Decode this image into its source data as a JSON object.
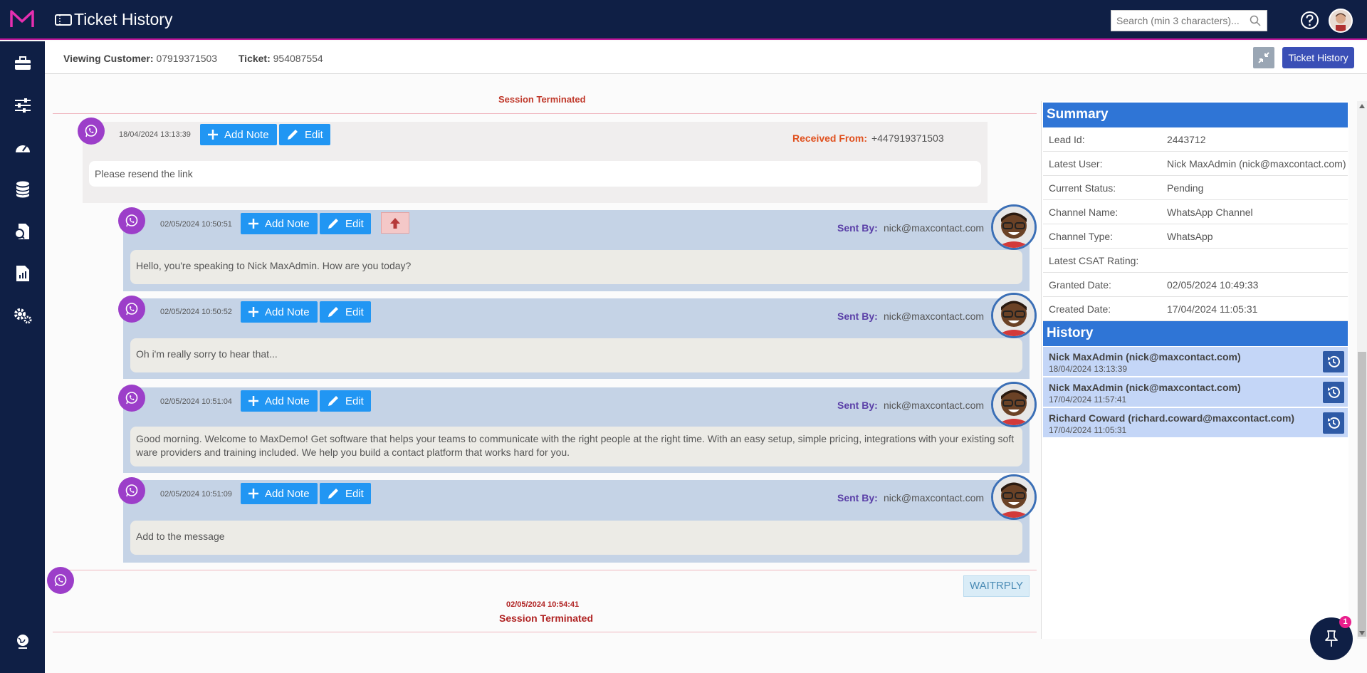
{
  "header": {
    "title": "Ticket History",
    "search_placeholder": "Search (min 3 characters)..."
  },
  "customer_bar": {
    "viewing_label": "Viewing Customer:",
    "viewing_value": "07919371503",
    "ticket_label": "Ticket:",
    "ticket_value": "954087554",
    "ticket_history_button": "Ticket History"
  },
  "chat": {
    "top_partial_status": "Session Terminated",
    "received_message": {
      "timestamp": "18/04/2024 13:13:39",
      "from_label": "Received From:",
      "from_value": "+447919371503",
      "text": "Please resend the link"
    },
    "buttons": {
      "add_note": "Add Note",
      "edit": "Edit"
    },
    "sent_by_label": "Sent By:",
    "sent_messages": [
      {
        "timestamp": "02/05/2024 10:50:51",
        "sender": "nick@maxcontact.com",
        "text": "Hello, you're speaking to Nick MaxAdmin. How are you today?"
      },
      {
        "timestamp": "02/05/2024 10:50:52",
        "sender": "nick@maxcontact.com",
        "text": "Oh i'm really sorry to hear that..."
      },
      {
        "timestamp": "02/05/2024 10:51:04",
        "sender": "nick@maxcontact.com",
        "text": "Good morning. Welcome to MaxDemo! Get software that helps your teams to communicate with the right people at the right time. With an easy setup, simple pricing, integrations with your existing software providers and training included. We help you build a contact platform that works hard for you."
      },
      {
        "timestamp": "02/05/2024 10:51:09",
        "sender": "nick@maxcontact.com",
        "text": "Add to the message"
      }
    ],
    "wait_badge": "WAITRPLY",
    "end_timestamp": "02/05/2024 10:54:41",
    "end_status": "Session Terminated"
  },
  "summary": {
    "title": "Summary",
    "rows": [
      {
        "key": "Lead Id:",
        "value": "2443712"
      },
      {
        "key": "Latest User:",
        "value": "Nick MaxAdmin (nick@maxcontact.com)"
      },
      {
        "key": "Current Status:",
        "value": "Pending"
      },
      {
        "key": "Channel Name:",
        "value": "WhatsApp Channel"
      },
      {
        "key": "Channel Type:",
        "value": "WhatsApp"
      },
      {
        "key": "Latest CSAT Rating:",
        "value": ""
      },
      {
        "key": "Granted Date:",
        "value": "02/05/2024 10:49:33"
      },
      {
        "key": "Created Date:",
        "value": "17/04/2024 11:05:31"
      }
    ]
  },
  "history": {
    "title": "History",
    "items": [
      {
        "name": "Nick MaxAdmin (nick@maxcontact.com)",
        "date": "18/04/2024 13:13:39"
      },
      {
        "name": "Nick MaxAdmin (nick@maxcontact.com)",
        "date": "17/04/2024 11:57:41"
      },
      {
        "name": "Richard Coward (richard.coward@maxcontact.com)",
        "date": "17/04/2024 11:05:31"
      }
    ]
  },
  "pin_badge": "1",
  "colors": {
    "navy": "#0f1f45",
    "accent_pink": "#c0189b",
    "button_blue": "#2196f3",
    "panel_blue": "#2f75d6",
    "whatsapp_purple": "#9c3ec9",
    "sent_bg": "#c5d3e6",
    "terminated_red": "#b02323"
  },
  "icons": {
    "logo": "maxcontact-logo",
    "sidebar": [
      "briefcase-icon",
      "sliders-icon",
      "dashboard-icon",
      "database-icon",
      "document-icon",
      "report-icon",
      "settings-icon",
      "globe-icon"
    ],
    "message": "whatsapp-icon",
    "history_button": "history-icon",
    "fab": "pin-icon"
  }
}
